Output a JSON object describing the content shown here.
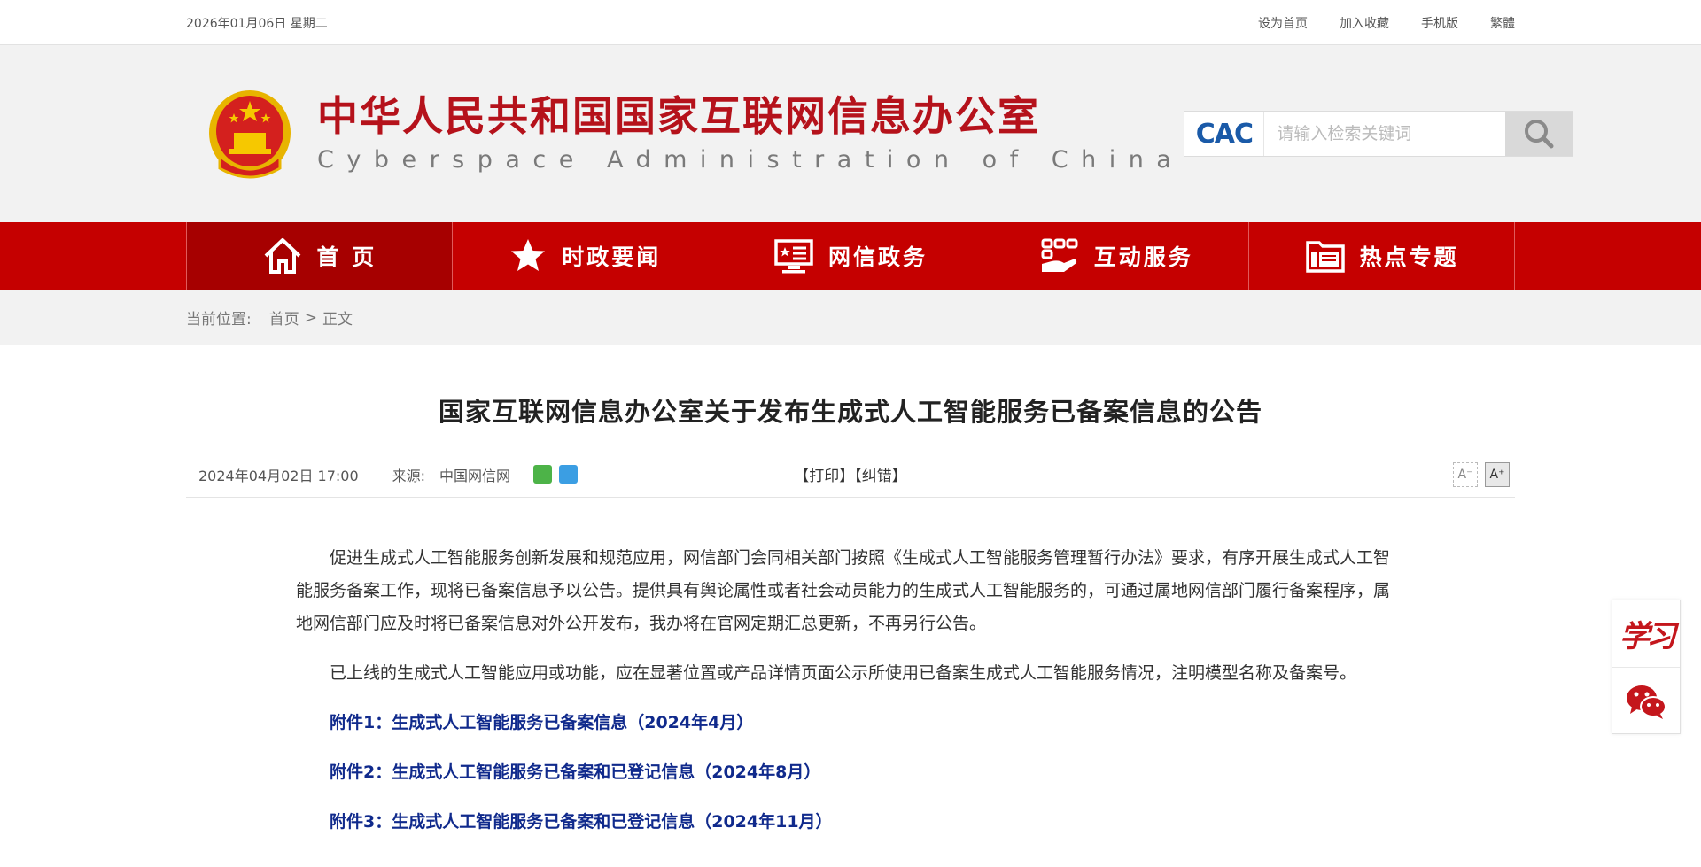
{
  "topbar": {
    "date": "2026年01月06日  星期二",
    "links": [
      "设为首页",
      "加入收藏",
      "手机版",
      "繁體"
    ]
  },
  "header": {
    "title_cn": "中华人民共和国国家互联网信息办公室",
    "title_en": "Cyberspace  Administration  of  China",
    "search_logo": "CAC",
    "search_placeholder": "请输入检索关键词"
  },
  "nav": [
    {
      "label": "首 页",
      "icon": "home-icon"
    },
    {
      "label": "时政要闻",
      "icon": "star-icon"
    },
    {
      "label": "网信政务",
      "icon": "monitor-icon"
    },
    {
      "label": "互动服务",
      "icon": "hand-service-icon"
    },
    {
      "label": "热点专题",
      "icon": "folder-icon"
    }
  ],
  "breadcrumb": {
    "label": "当前位置:",
    "home": "首页",
    "sep": ">",
    "current": "正文"
  },
  "article": {
    "title": "国家互联网信息办公室关于发布生成式人工智能服务已备案信息的公告",
    "datetime": "2024年04月02日 17:00",
    "source_label": "来源:",
    "source": "中国网信网",
    "print": "【打印】",
    "correct": "【纠错】",
    "font_small": "A⁻",
    "font_large": "A⁺",
    "paragraphs": [
      "促进生成式人工智能服务创新发展和规范应用，网信部门会同相关部门按照《生成式人工智能服务管理暂行办法》要求，有序开展生成式人工智能服务备案工作，现将已备案信息予以公告。提供具有舆论属性或者社会动员能力的生成式人工智能服务的，可通过属地网信部门履行备案程序，属地网信部门应及时将已备案信息对外公开发布，我办将在官网定期汇总更新，不再另行公告。",
      "已上线的生成式人工智能应用或功能，应在显著位置或产品详情页面公示所使用已备案生成式人工智能服务情况，注明模型名称及备案号。"
    ],
    "attachments": [
      "附件1：生成式人工智能服务已备案信息（2024年4月）",
      "附件2：生成式人工智能服务已备案和已登记信息（2024年8月）",
      "附件3：生成式人工智能服务已备案和已登记信息（2024年11月）"
    ]
  },
  "float": {
    "xuexi": "学习"
  },
  "colors": {
    "brand_red": "#c50000",
    "title_red": "#b5121b",
    "link_blue": "#102a8c"
  }
}
